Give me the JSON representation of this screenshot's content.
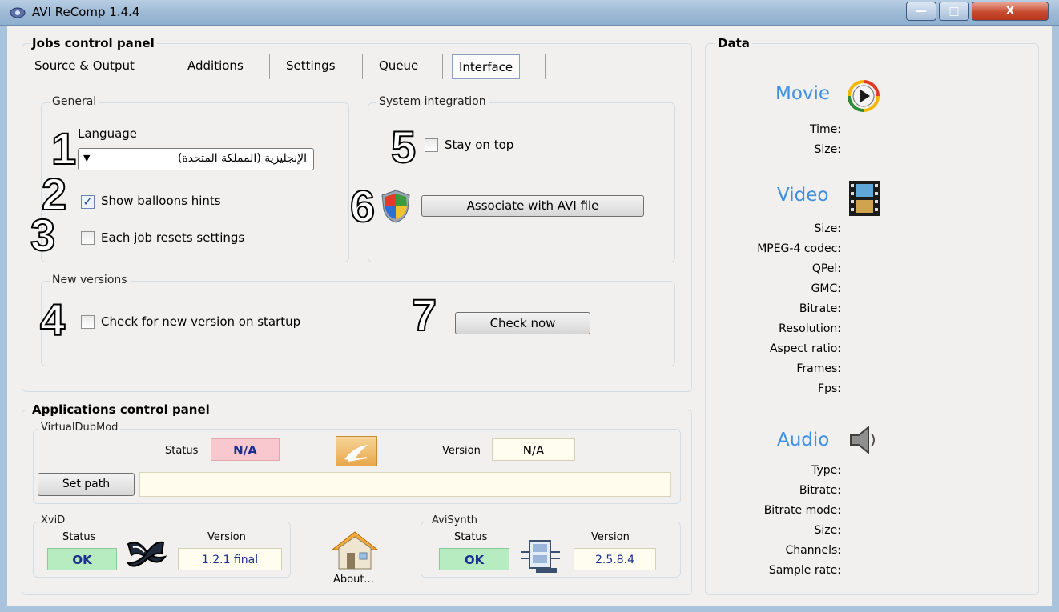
{
  "window": {
    "title": "AVI ReComp  1.4.4",
    "minimize_glyph": "—",
    "maximize_glyph": "□",
    "close_glyph": "X"
  },
  "jobs_panel": {
    "title": "Jobs control panel",
    "tabs": [
      "Source & Output",
      "Additions",
      "Settings",
      "Queue",
      "Interface"
    ],
    "active_tab": "Interface",
    "general": {
      "title": "General",
      "language_label": "Language",
      "language_value": "الإنجليزية (المملكة المتحدة)",
      "show_balloons_label": "Show balloons hints",
      "show_balloons_checked": true,
      "each_job_resets_label": "Each job resets settings",
      "each_job_resets_checked": false
    },
    "system_integration": {
      "title": "System integration",
      "stay_on_top_label": "Stay on top",
      "stay_on_top_checked": false,
      "associate_button": "Associate with AVI file"
    },
    "new_versions": {
      "title": "New versions",
      "check_startup_label": "Check for new version on startup",
      "check_startup_checked": false,
      "check_now_button": "Check now"
    },
    "annotations": [
      "1",
      "2",
      "3",
      "4",
      "5",
      "6",
      "7"
    ]
  },
  "apps_panel": {
    "title": "Applications control panel",
    "virtualdubmod": {
      "title": "VirtualDubMod",
      "status_label": "Status",
      "status_value": "N/A",
      "version_label": "Version",
      "version_value": "N/A",
      "set_path_button": "Set path",
      "path_value": ""
    },
    "xvid": {
      "title": "XviD",
      "status_label": "Status",
      "status_value": "OK",
      "version_label": "Version",
      "version_value": "1.2.1 final"
    },
    "about_label": "About...",
    "avisynth": {
      "title": "AviSynth",
      "status_label": "Status",
      "status_value": "OK",
      "version_label": "Version",
      "version_value": "2.5.8.4"
    }
  },
  "data_panel": {
    "title": "Data",
    "movie": {
      "title": "Movie",
      "fields": [
        "Time:",
        "Size:"
      ]
    },
    "video": {
      "title": "Video",
      "fields": [
        "Size:",
        "MPEG-4 codec:",
        "QPel:",
        "GMC:",
        "Bitrate:",
        "Resolution:",
        "Aspect ratio:",
        "Frames:",
        "Fps:"
      ]
    },
    "audio": {
      "title": "Audio",
      "fields": [
        "Type:",
        "Bitrate:",
        "Bitrate mode:",
        "Size:",
        "Channels:",
        "Sample rate:"
      ]
    }
  },
  "colors": {
    "na_status_bg": "#f9c8cf",
    "ok_status_bg": "#b7ecc0",
    "section_title": "#3d8fe0",
    "window_frame": "#a9c3dd"
  }
}
